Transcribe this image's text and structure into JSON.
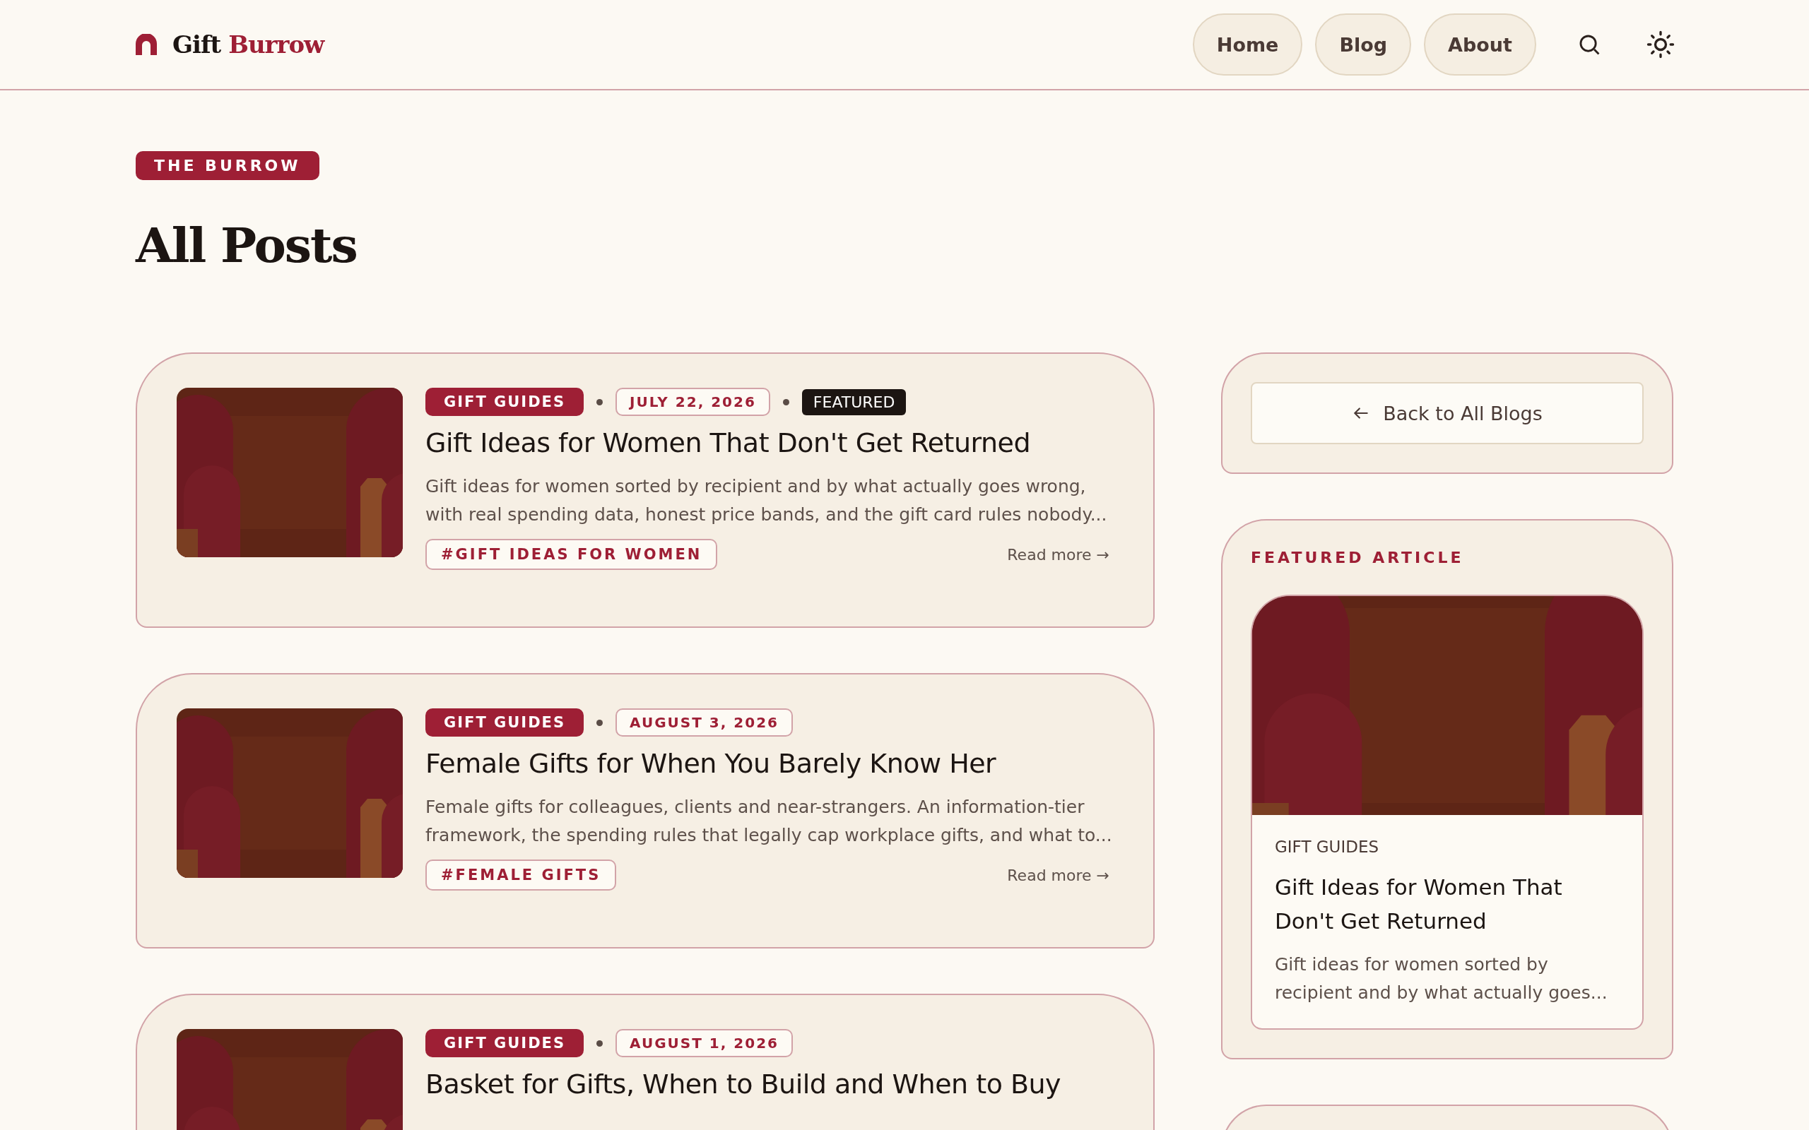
{
  "header": {
    "brand": {
      "first": "Gift",
      "second": "Burrow"
    },
    "nav": [
      {
        "label": "Home"
      },
      {
        "label": "Blog"
      },
      {
        "label": "About"
      }
    ]
  },
  "hero": {
    "eyebrow": "THE BURROW",
    "title": "All Posts"
  },
  "posts": [
    {
      "category": "GIFT GUIDES",
      "date": "JULY 22, 2026",
      "featured": true,
      "featured_label": "FEATURED",
      "title": "Gift Ideas for Women That Don't Get Returned",
      "excerpt": "Gift ideas for women sorted by recipient and by what actually goes wrong, with real spending data, honest price bands, and the gift card rules nobody...",
      "tag": "#GIFT IDEAS FOR WOMEN",
      "read_more": "Read more →"
    },
    {
      "category": "GIFT GUIDES",
      "date": "AUGUST 3, 2026",
      "featured": false,
      "title": "Female Gifts for When You Barely Know Her",
      "excerpt": "Female gifts for colleagues, clients and near-strangers. An information-tier framework, the spending rules that legally cap workplace gifts, and what to...",
      "tag": "#FEMALE GIFTS",
      "read_more": "Read more →"
    },
    {
      "category": "GIFT GUIDES",
      "date": "AUGUST 1, 2026",
      "featured": false,
      "title": "Basket for Gifts, When to Build and When to Buy"
    }
  ],
  "sidebar": {
    "back_button": "Back to All Blogs",
    "featured": {
      "heading": "FEATURED ARTICLE",
      "category": "GIFT GUIDES",
      "title": "Gift Ideas for Women That Don't Get Returned",
      "excerpt": "Gift ideas for women sorted by recipient and by what actually goes..."
    }
  }
}
